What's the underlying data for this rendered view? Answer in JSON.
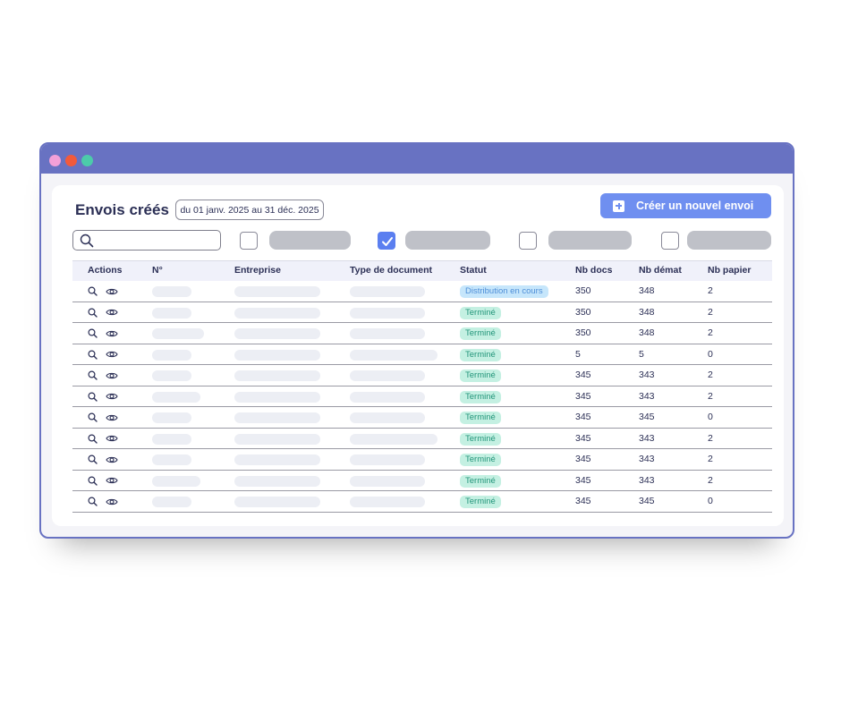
{
  "page": {
    "title": "Envois créés",
    "date_range": "du 01 janv. 2025 au 31 déc. 2025",
    "create_button": "Créer un nouvel envoi"
  },
  "search": {
    "placeholder": ""
  },
  "filters": [
    {
      "checked": false
    },
    {
      "checked": true
    },
    {
      "checked": false
    },
    {
      "checked": false
    }
  ],
  "table": {
    "columns": [
      "Actions",
      "N°",
      "Entreprise",
      "Type de document",
      "Statut",
      "Nb docs",
      "Nb démat",
      "Nb papier"
    ],
    "rows": [
      {
        "status": "Distribution en cours",
        "status_kind": "progress",
        "docs": "350",
        "demat": "348",
        "papier": "2"
      },
      {
        "status": "Terminé",
        "status_kind": "done",
        "docs": "350",
        "demat": "348",
        "papier": "2"
      },
      {
        "status": "Terminé",
        "status_kind": "done",
        "docs": "350",
        "demat": "348",
        "papier": "2"
      },
      {
        "status": "Terminé",
        "status_kind": "done",
        "docs": "5",
        "demat": "5",
        "papier": "0"
      },
      {
        "status": "Terminé",
        "status_kind": "done",
        "docs": "345",
        "demat": "343",
        "papier": "2"
      },
      {
        "status": "Terminé",
        "status_kind": "done",
        "docs": "345",
        "demat": "343",
        "papier": "2"
      },
      {
        "status": "Terminé",
        "status_kind": "done",
        "docs": "345",
        "demat": "345",
        "papier": "0"
      },
      {
        "status": "Terminé",
        "status_kind": "done",
        "docs": "345",
        "demat": "343",
        "papier": "2"
      },
      {
        "status": "Terminé",
        "status_kind": "done",
        "docs": "345",
        "demat": "343",
        "papier": "2"
      },
      {
        "status": "Terminé",
        "status_kind": "done",
        "docs": "345",
        "demat": "343",
        "papier": "2"
      },
      {
        "status": "Terminé",
        "status_kind": "done",
        "docs": "345",
        "demat": "345",
        "papier": "0"
      }
    ]
  },
  "icons": {
    "row_actions": [
      "zoom-icon",
      "eye-icon"
    ],
    "search": "search-icon",
    "create": "plus-icon",
    "checkbox": "check-icon"
  },
  "colors": {
    "window_frame": "#6872c2",
    "accent_button": "#6f8ff0",
    "checkbox_checked": "#5b7ff0",
    "status_progress_bg": "#c6e6fb",
    "status_progress_text": "#4f8fd8",
    "status_done_bg": "#c4f0e2",
    "status_done_text": "#23957a",
    "dot_pink": "#f2a0d8",
    "dot_red": "#f25a3b",
    "dot_green": "#4ccbaa"
  }
}
